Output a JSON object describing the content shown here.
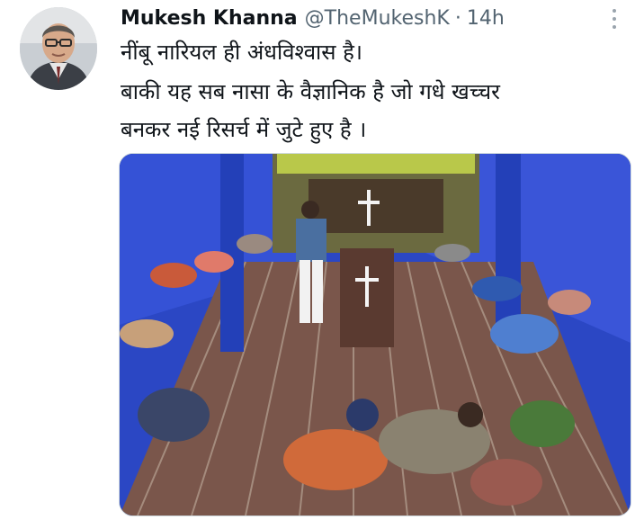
{
  "tweet": {
    "author_name": "Mukesh Khanna",
    "handle": "@TheMukeshK",
    "separator": "·",
    "time": "14h",
    "text_lines": [
      "नींबू नारियल ही अंधविश्वास है।",
      "बाकी यह सब नासा के वैज्ञानिक है जो गधे खच्चर",
      "बनकर नई रिसर्च में जुटे हुए है ।"
    ]
  },
  "icons": {
    "more": "more-options-icon",
    "avatar": "avatar-image",
    "media": "church-prayer-photo"
  },
  "colors": {
    "text_primary": "#0f1419",
    "text_secondary": "#536471",
    "wall_blue": "#2f4fc9",
    "carpet_brown": "#7d5a4e"
  }
}
